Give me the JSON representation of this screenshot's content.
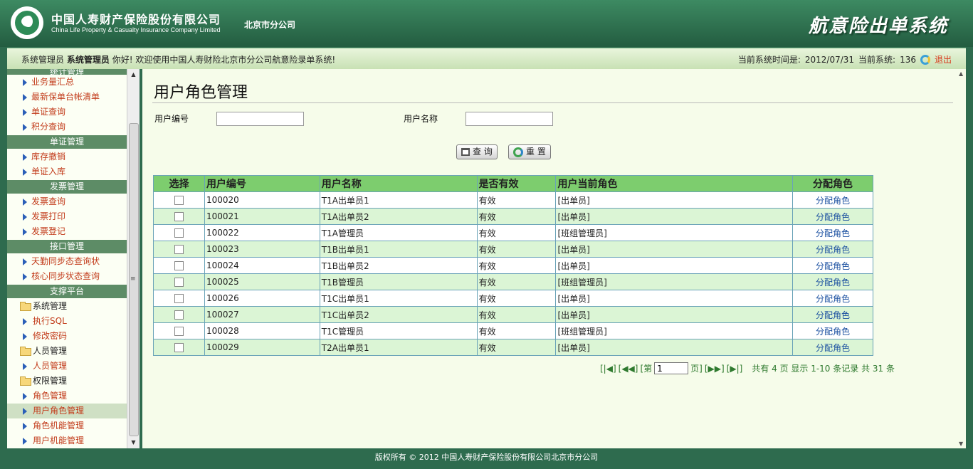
{
  "header": {
    "company_cn": "中国人寿财产保险股份有限公司",
    "company_en": "China Life Property & Casualty Insurance Company Limited",
    "branch": "北京市分公司",
    "system_title": "航意险出单系统"
  },
  "status": {
    "role": "系统管理员",
    "user": "系统管理员",
    "greeting": "你好!",
    "welcome": "欢迎使用中国人寿财险北京市分公司航意险录单系统!",
    "time_label": "当前系统时间是:",
    "time_value": "2012/07/31",
    "system_label": "当前系统:",
    "system_value": "136",
    "logout": "退出"
  },
  "sidebar": {
    "clipped_group": "统计管理",
    "stats_items": [
      "业务量汇总",
      "最新保单台帐清单",
      "单证查询",
      "积分查询"
    ],
    "group_certificate": "单证管理",
    "certificate_items": [
      "库存撤销",
      "单证入库"
    ],
    "group_invoice": "发票管理",
    "invoice_items": [
      "发票查询",
      "发票打印",
      "发票登记"
    ],
    "group_interface": "接口管理",
    "interface_items": [
      "天勤同步态查询状",
      "核心同步状态查询"
    ],
    "group_support": "支撑平台",
    "folder_system": "系统管理",
    "system_items": [
      "执行SQL",
      "修改密码"
    ],
    "folder_people": "人员管理",
    "people_items": [
      "人员管理"
    ],
    "folder_perm": "权限管理",
    "perm_items": [
      "角色管理",
      "用户角色管理",
      "角色机能管理",
      "用户机能管理"
    ]
  },
  "page": {
    "title": "用户角色管理",
    "user_id_label": "用户编号",
    "user_name_label": "用户名称",
    "user_id_value": "",
    "user_name_value": "",
    "query_button": "查 询",
    "reset_button": "重 置"
  },
  "table": {
    "headers": [
      "选择",
      "用户编号",
      "用户名称",
      "是否有效",
      "用户当前角色",
      "分配角色"
    ],
    "rows": [
      {
        "id": "100020",
        "name": "T1A出单员1",
        "valid": "有效",
        "role": "[出单员]",
        "action": "分配角色"
      },
      {
        "id": "100021",
        "name": "T1A出单员2",
        "valid": "有效",
        "role": "[出单员]",
        "action": "分配角色"
      },
      {
        "id": "100022",
        "name": "T1A管理员",
        "valid": "有效",
        "role": "[班组管理员]",
        "action": "分配角色"
      },
      {
        "id": "100023",
        "name": "T1B出单员1",
        "valid": "有效",
        "role": "[出单员]",
        "action": "分配角色"
      },
      {
        "id": "100024",
        "name": "T1B出单员2",
        "valid": "有效",
        "role": "[出单员]",
        "action": "分配角色"
      },
      {
        "id": "100025",
        "name": "T1B管理员",
        "valid": "有效",
        "role": "[班组管理员]",
        "action": "分配角色"
      },
      {
        "id": "100026",
        "name": "T1C出单员1",
        "valid": "有效",
        "role": "[出单员]",
        "action": "分配角色"
      },
      {
        "id": "100027",
        "name": "T1C出单员2",
        "valid": "有效",
        "role": "[出单员]",
        "action": "分配角色"
      },
      {
        "id": "100028",
        "name": "T1C管理员",
        "valid": "有效",
        "role": "[班组管理员]",
        "action": "分配角色"
      },
      {
        "id": "100029",
        "name": "T2A出单员1",
        "valid": "有效",
        "role": "[出单员]",
        "action": "分配角色"
      }
    ]
  },
  "pager": {
    "first": "[|◀]",
    "prev": "[◀◀]",
    "page_prefix": "[第",
    "page_value": "1",
    "page_suffix": "页]",
    "next": "[▶▶]",
    "last": "[▶|]",
    "info": "共有 4 页  显示 1-10 条记录  共 31 条"
  },
  "footer": {
    "text": "版权所有 ©  2012 中国人寿财产保险股份有限公司北京市分公司"
  }
}
